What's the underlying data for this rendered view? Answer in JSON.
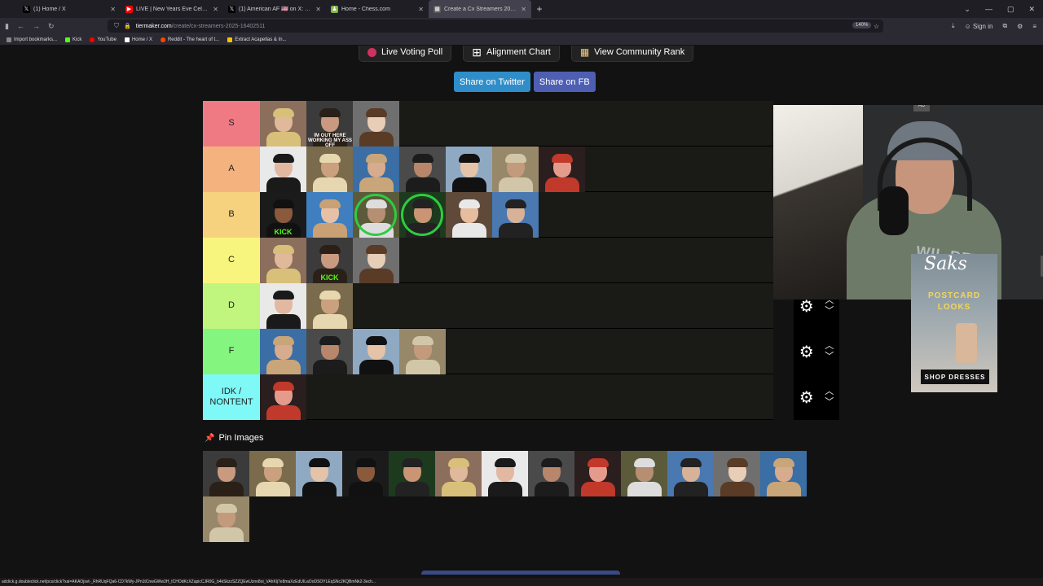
{
  "tabs": [
    {
      "label": "(1) Home / X",
      "icon": "x-logo-icon",
      "color": "#000000"
    },
    {
      "label": "LIVE | New Years Eve Celebratio",
      "icon": "youtube-icon",
      "color": "#ff0000"
    },
    {
      "label": "(1) American AF 🇺🇸 on X: \"A ma",
      "icon": "x-logo-icon",
      "color": "#000000"
    },
    {
      "label": "Home - Chess.com",
      "icon": "chess-icon",
      "color": "#81b64c"
    },
    {
      "label": "Create a Cx Streamers 2025 Tier",
      "icon": "tiermaker-icon",
      "color": "#5a5a5a",
      "active": true
    }
  ],
  "address": {
    "host": "tiermaker.com",
    "path": "/create/cx-streamers-2025-16402511"
  },
  "zoom": "140%",
  "signin": "Sign in",
  "bookmarks": [
    {
      "label": "Import bookmarks...",
      "color": "#888888"
    },
    {
      "label": "Kick",
      "color": "#53fc18"
    },
    {
      "label": "YouTube",
      "color": "#ff0000"
    },
    {
      "label": "Home / X",
      "color": "#ffffff"
    },
    {
      "label": "Reddit - The heart of t...",
      "color": "#ff4500"
    },
    {
      "label": "Extract Acapellas & In...",
      "color": "#f5c400"
    }
  ],
  "buttons": {
    "poll": "Live Voting Poll",
    "alignment": "Alignment Chart",
    "community": "View Community Rank",
    "share_twitter": "Share on Twitter",
    "share_fb": "Share on FB"
  },
  "tiers": [
    {
      "label": "S",
      "color": "#f07a83",
      "count": 3
    },
    {
      "label": "A",
      "color": "#f4b27e",
      "count": 7
    },
    {
      "label": "B",
      "color": "#f6d27e",
      "count": 6
    },
    {
      "label": "C",
      "color": "#f8f57e",
      "count": 3
    },
    {
      "label": "D",
      "color": "#c0f57e",
      "count": 2
    },
    {
      "label": "F",
      "color": "#84f57e",
      "count": 4
    },
    {
      "label": "IDK / NONTENT",
      "color": "#7ef9f8",
      "count": 1
    }
  ],
  "thumb_captions": {
    "im_out_here": "IM OUT HERE WORKING MY ASS OFF",
    "kick": "KICK"
  },
  "pin_heading": "Pin Images",
  "pin_count": 14,
  "ad": {
    "brand": "Saks",
    "sub1": "POSTCARD",
    "sub2": "LOOKS",
    "cta": "SHOP DRESSES"
  },
  "webcam_shirt_text": "WIL REV",
  "status_url": "adclick.g.doubleclick.net/pcs/click?xai=AKAOjsvt-_RhRUqFQa6-CD7kWy-JPn1tCnwGWw3H_tCHOdKcXZapicCJR0G_b4kSkzzSZZQEwUzno8oi_VAhKlj7e8maXzEdUILaOoDSOYLEqSNc2KQBmNk2-3ech..."
}
